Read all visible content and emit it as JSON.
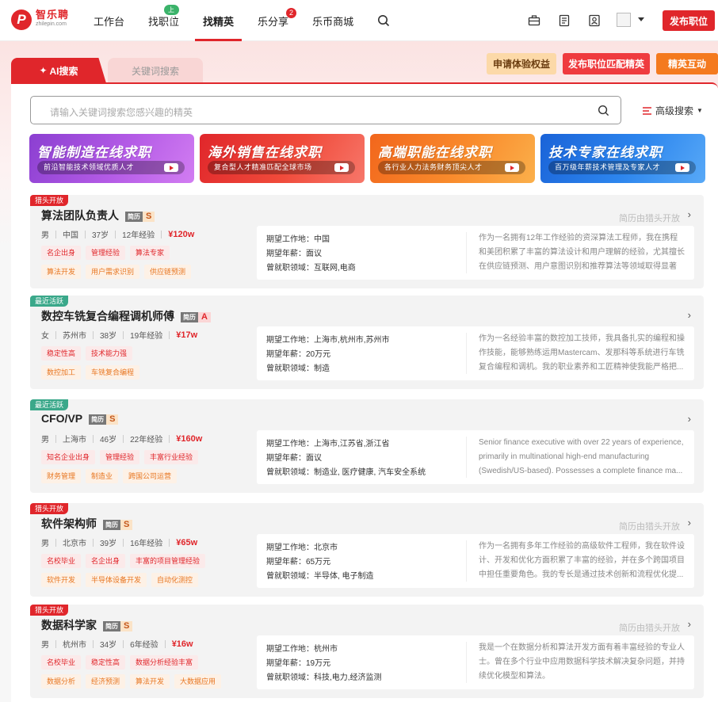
{
  "header": {
    "logo_name": "智乐聘",
    "logo_sub": "zhilepin.com",
    "nav": [
      {
        "label": "工作台"
      },
      {
        "label": "找职位",
        "badge": "上新"
      },
      {
        "label": "找精英",
        "active": true
      },
      {
        "label": "乐分享",
        "count": "2"
      },
      {
        "label": "乐币商城"
      }
    ],
    "publish_label": "发布职位"
  },
  "search_area": {
    "tab_ai": "AI搜索",
    "tab_keyword": "关键词搜索",
    "placeholder": "请输入关键词搜索您感兴趣的精英",
    "advanced": "高级搜索",
    "actions": [
      "申请体验权益",
      "发布职位匹配精英",
      "精英互动"
    ]
  },
  "banners": [
    {
      "title": "智能制造在线求职",
      "sub": "前沿智能技术领域优质人才"
    },
    {
      "title": "海外销售在线求职",
      "sub": "复合型人才精准匹配全球市场"
    },
    {
      "title": "高端职能在线求职",
      "sub": "各行业人力法务财务顶尖人才"
    },
    {
      "title": "技术专家在线求职",
      "sub": "百万级年薪技术管理及专家人才"
    }
  ],
  "candidates": [
    {
      "tag": "猎头开放",
      "tag_color": "#e0262b",
      "name": "算法团队负责人",
      "resume_label": "简历",
      "grade": "S",
      "status": "简历由猎头开放",
      "gender": "男",
      "location": "中国",
      "age": "37岁",
      "experience": "12年经验",
      "salary": "¥120w",
      "tags_row1": [
        "名企出身",
        "管理经验",
        "算法专家"
      ],
      "tags_row2": [
        "算法开发",
        "用户需求识别",
        "供应链预测"
      ],
      "expect_location": "期望工作地：中国",
      "expect_salary": "期望年薪：面议",
      "domain": "曾就职领域：互联网,电商",
      "summary": "作为一名拥有12年工作经验的资深算法工程师，我在携程和美团积累了丰富的算法设计和用户理解的经验，尤其擅长在供应链预测、用户意图识别和推荐算法等领域取得显著成..."
    },
    {
      "tag": "最近活跃",
      "tag_color": "#3aa88a",
      "name": "数控车铣复合编程调机师傅",
      "resume_label": "简历",
      "grade": "A",
      "status": "",
      "gender": "女",
      "location": "苏州市",
      "age": "38岁",
      "experience": "19年经验",
      "salary": "¥17w",
      "tags_row1": [
        "稳定性高",
        "技术能力强"
      ],
      "tags_row2": [
        "数控加工",
        "车铣复合编程"
      ],
      "expect_location": "期望工作地：上海市,杭州市,苏州市",
      "expect_salary": "期望年薪：20万元",
      "domain": "曾就职领域：制造",
      "summary": "作为一名经验丰富的数控加工技师，我具备扎实的编程和操作技能，能够熟练运用Mastercam、发那科等系统进行车铣复合编程和调机。我的职业素养和工匠精神使我能严格把..."
    },
    {
      "tag": "最近活跃",
      "tag_color": "#3aa88a",
      "name": "CFO/VP",
      "resume_label": "简历",
      "grade": "S",
      "status": "",
      "gender": "男",
      "location": "上海市",
      "age": "46岁",
      "experience": "22年经验",
      "salary": "¥160w",
      "tags_row1": [
        "知名企业出身",
        "管理经验",
        "丰富行业经验"
      ],
      "tags_row2": [
        "财务管理",
        "制造业",
        "跨国公司运营"
      ],
      "expect_location": "期望工作地：上海市,江苏省,浙江省",
      "expect_salary": "期望年薪：面议",
      "domain": "曾就职领域：制造业, 医疗健康, 汽车安全系统",
      "summary": "Senior finance executive with over 22 years of experience, primarily in multinational high-end manufacturing (Swedish/US-based). Possesses a complete finance ma..."
    },
    {
      "tag": "猎头开放",
      "tag_color": "#e0262b",
      "name": "软件架构师",
      "resume_label": "简历",
      "grade": "S",
      "status": "简历由猎头开放",
      "gender": "男",
      "location": "北京市",
      "age": "39岁",
      "experience": "16年经验",
      "salary": "¥65w",
      "tags_row1": [
        "名校毕业",
        "名企出身",
        "丰富的项目管理经验"
      ],
      "tags_row2": [
        "软件开发",
        "半导体设备开发",
        "自动化测控"
      ],
      "expect_location": "期望工作地：北京市",
      "expect_salary": "期望年薪：65万元",
      "domain": "曾就职领域：半导体, 电子制造",
      "summary": "作为一名拥有多年工作经验的高级软件工程师，我在软件设计、开发和优化方面积累了丰富的经验，并在多个跨国项目中担任重要角色。我的专长是通过技术创新和流程优化提..."
    },
    {
      "tag": "猎头开放",
      "tag_color": "#e0262b",
      "name": "数据科学家",
      "resume_label": "简历",
      "grade": "S",
      "status": "简历由猎头开放",
      "gender": "男",
      "location": "杭州市",
      "age": "34岁",
      "experience": "6年经验",
      "salary": "¥16w",
      "tags_row1": [
        "名校毕业",
        "稳定性高",
        "数据分析经验丰富"
      ],
      "tags_row2": [
        "数据分析",
        "经济预测",
        "算法开发",
        "大数据应用"
      ],
      "expect_location": "期望工作地：杭州市",
      "expect_salary": "期望年薪：19万元",
      "domain": "曾就职领域：科技,电力,经济监测",
      "summary": "我是一个在数据分析和算法开发方面有着丰富经验的专业人士。曾在多个行业中应用数据科学技术解决复杂问题，并持续优化模型和算法。"
    }
  ]
}
